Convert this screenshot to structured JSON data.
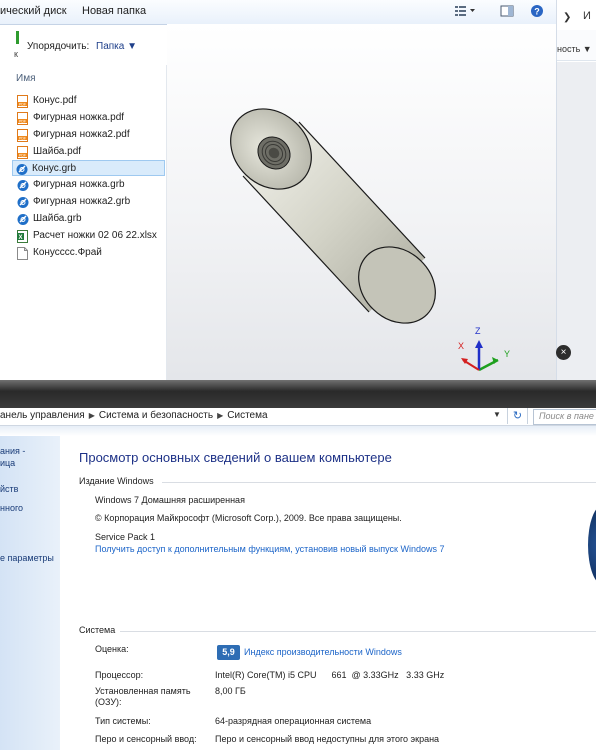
{
  "explorer": {
    "breadcrumb": [
      "ический диск",
      "Новая папка"
    ],
    "toolbar": {
      "organize": "Упорядочить:",
      "folder": "Папка ▼"
    },
    "right_strip": {
      "menu_edge": "И",
      "options_edge": "ность ▼"
    },
    "list_header": "Имя",
    "files": [
      {
        "name": "Конус.pdf",
        "icon": "pdf-icon"
      },
      {
        "name": "Фигурная ножка.pdf",
        "icon": "pdf-icon"
      },
      {
        "name": "Фигурная ножка2.pdf",
        "icon": "pdf-icon"
      },
      {
        "name": "Шайба.pdf",
        "icon": "pdf-icon"
      },
      {
        "name": "Конус.grb",
        "icon": "grb-icon",
        "selected": true
      },
      {
        "name": "Фигурная ножка.grb",
        "icon": "grb-icon"
      },
      {
        "name": "Фигурная ножка2.grb",
        "icon": "grb-icon"
      },
      {
        "name": "Шайба.grb",
        "icon": "grb-icon"
      },
      {
        "name": "Расчет ножки 02 06 22.xlsx",
        "icon": "excel-icon"
      },
      {
        "name": "Конусссс.Фрай",
        "icon": "blank-file-icon"
      }
    ],
    "axes": {
      "x": "X",
      "y": "Y",
      "z": "Z"
    },
    "colors": {
      "x_axis": "#d42020",
      "y_axis": "#1ea01e",
      "z_axis": "#2030c8"
    }
  },
  "control_panel": {
    "address": [
      "анель управления",
      "Система и безопасность",
      "Система"
    ],
    "search_placeholder": "Поиск в пане",
    "left_nav": [
      "ания -",
      "ица",
      "йств",
      "нного",
      "е параметры"
    ],
    "title": "Просмотр основных сведений о вашем компьютере",
    "windows_edition": {
      "header": "Издание Windows",
      "edition": "Windows 7 Домашняя расширенная",
      "copyright": "© Корпорация Майкрософт (Microsoft Corp.), 2009. Все права защищены.",
      "service_pack": "Service Pack 1",
      "upgrade_link": "Получить доступ к дополнительным функциям, установив новый выпуск Windows 7"
    },
    "system": {
      "header": "Система",
      "rating_label": "Оценка:",
      "rating_value": "5,9",
      "rating_link": "Индекс производительности Windows",
      "cpu_label": "Процессор:",
      "cpu_value": "Intel(R) Core(TM) i5 CPU      661  @ 3.33GHz   3.33 GHz",
      "ram_label_1": "Установленная память",
      "ram_label_2": "(ОЗУ):",
      "ram_value": "8,00 ГБ",
      "type_label": "Тип системы:",
      "type_value": "64-разрядная операционная система",
      "pen_label": "Перо и сенсорный ввод:",
      "pen_value": "Перо и сенсорный ввод недоступны для этого экрана"
    }
  }
}
